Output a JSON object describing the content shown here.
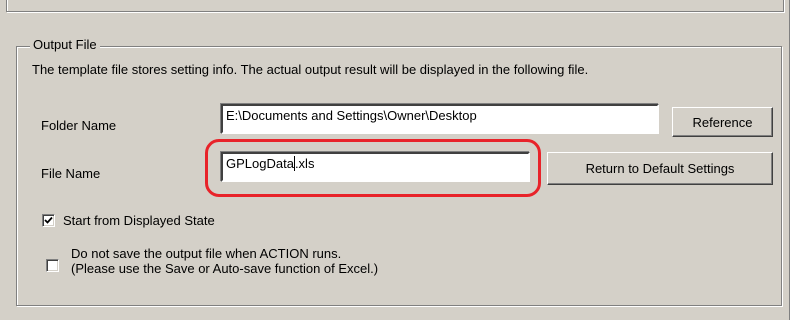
{
  "group": {
    "title": "Output File",
    "info": "The template file stores setting info. The actual output result will be displayed in the following file."
  },
  "folder": {
    "label": "Folder Name",
    "value": "E:\\Documents and Settings\\Owner\\Desktop",
    "button": "Reference"
  },
  "file": {
    "label": "File Name",
    "value_before_caret": "GPLogData",
    "value_after_caret": ".xls",
    "button": "Return to Default Settings"
  },
  "options": {
    "start_from_displayed": {
      "label": "Start from Displayed State",
      "checked": true
    },
    "do_not_save": {
      "line1": "Do not save the output file when ACTION runs.",
      "line2": "(Please use the Save or Auto-save function of Excel.)",
      "checked": false
    }
  },
  "colors": {
    "dialog_background": "#d4d0c8",
    "highlight": "#e8232a"
  },
  "icons": {
    "checkmark": "check-icon"
  }
}
